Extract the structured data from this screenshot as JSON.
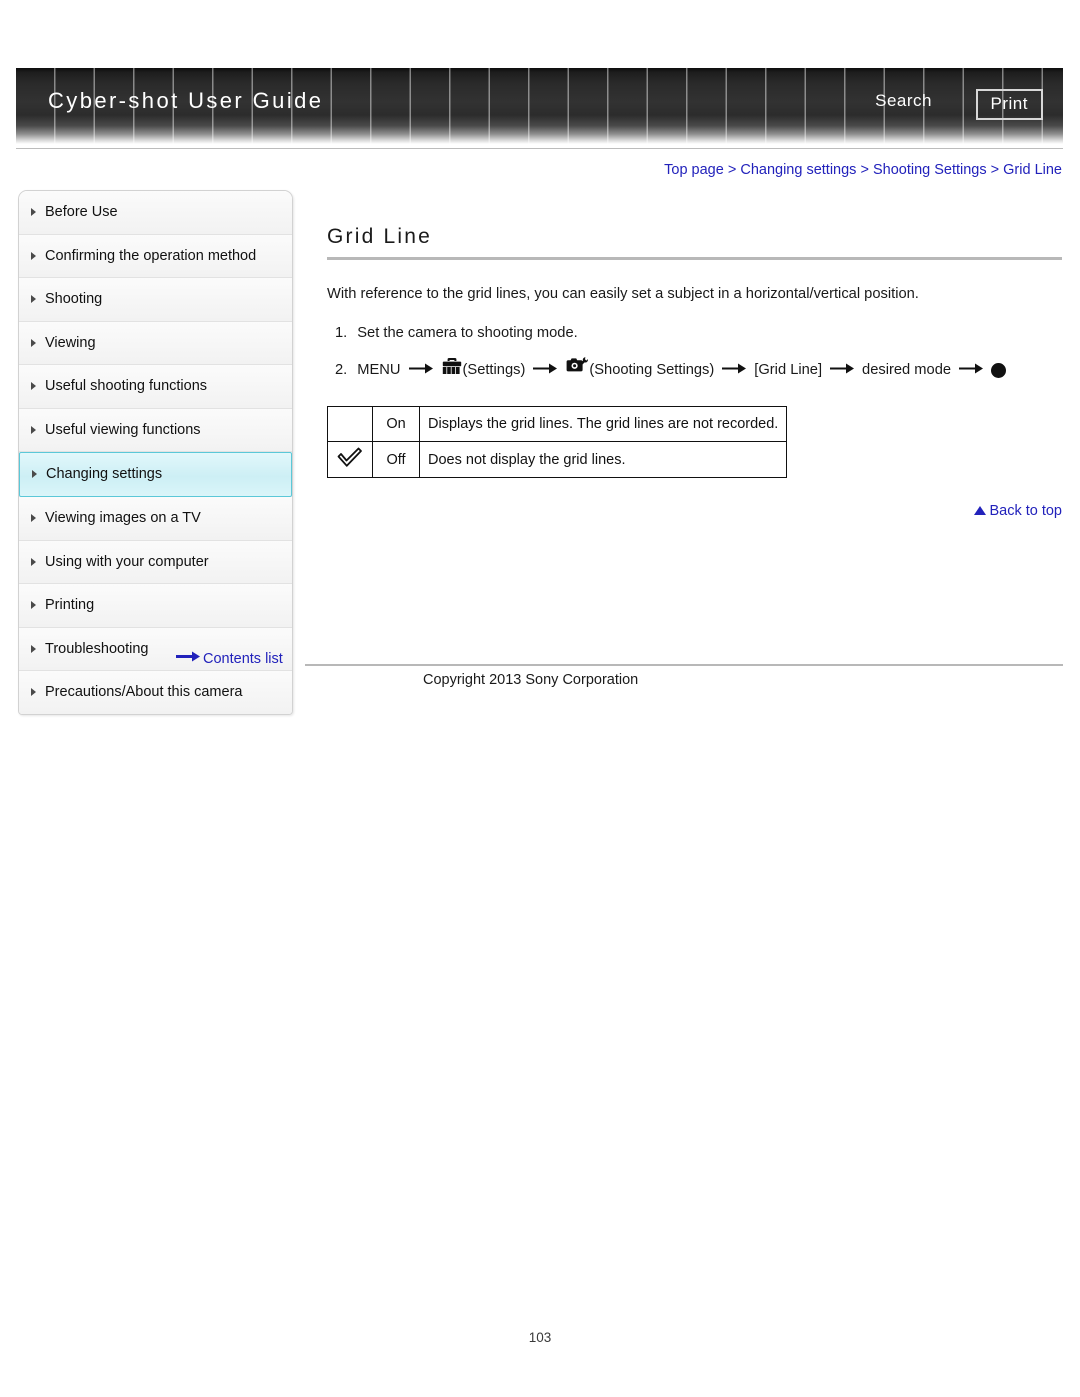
{
  "header": {
    "title": "Cyber-shot User Guide",
    "search_label": "Search",
    "print_label": "Print"
  },
  "breadcrumb": {
    "items": [
      {
        "label": "Top page"
      },
      {
        "label": "Changing settings"
      },
      {
        "label": "Shooting Settings"
      },
      {
        "label": "Grid Line"
      }
    ],
    "separator": ">"
  },
  "sidebar": {
    "items": [
      {
        "label": "Before Use",
        "active": false
      },
      {
        "label": "Confirming the operation method",
        "active": false
      },
      {
        "label": "Shooting",
        "active": false
      },
      {
        "label": "Viewing",
        "active": false
      },
      {
        "label": "Useful shooting functions",
        "active": false
      },
      {
        "label": "Useful viewing functions",
        "active": false
      },
      {
        "label": "Changing settings",
        "active": true
      },
      {
        "label": "Viewing images on a TV",
        "active": false
      },
      {
        "label": "Using with your computer",
        "active": false
      },
      {
        "label": "Printing",
        "active": false
      },
      {
        "label": "Troubleshooting",
        "active": false
      },
      {
        "label": "Precautions/About this camera",
        "active": false
      }
    ],
    "contents_list_label": "Contents list"
  },
  "main": {
    "title": "Grid Line",
    "intro": "With reference to the grid lines, you can easily set a subject in a horizontal/vertical position.",
    "step1": {
      "number": "1.",
      "text": "Set the camera to shooting mode."
    },
    "step2": {
      "number": "2.",
      "menu_label": "MENU",
      "settings_label": "(Settings)",
      "shooting_settings_label": "(Shooting Settings)",
      "grid_line_label": "[Grid Line]",
      "desired_mode_label": "desired mode",
      "settings_icon": "toolbox-icon",
      "shooting_settings_icon": "camera-wrench-icon",
      "confirm_icon": "filled-circle-icon"
    },
    "table": {
      "rows": [
        {
          "checked": "",
          "name": "On",
          "description": "Displays the grid lines. The grid lines are not recorded."
        },
        {
          "checked": "✓",
          "name": "Off",
          "description": "Does not display the grid lines."
        }
      ]
    },
    "back_to_top_label": "Back to top"
  },
  "footer": {
    "copyright": "Copyright 2013 Sony Corporation",
    "page_number": "103"
  },
  "colors": {
    "link": "#2222bb",
    "accent_active": "#5bc8d8",
    "rule": "#b8b8b8"
  }
}
